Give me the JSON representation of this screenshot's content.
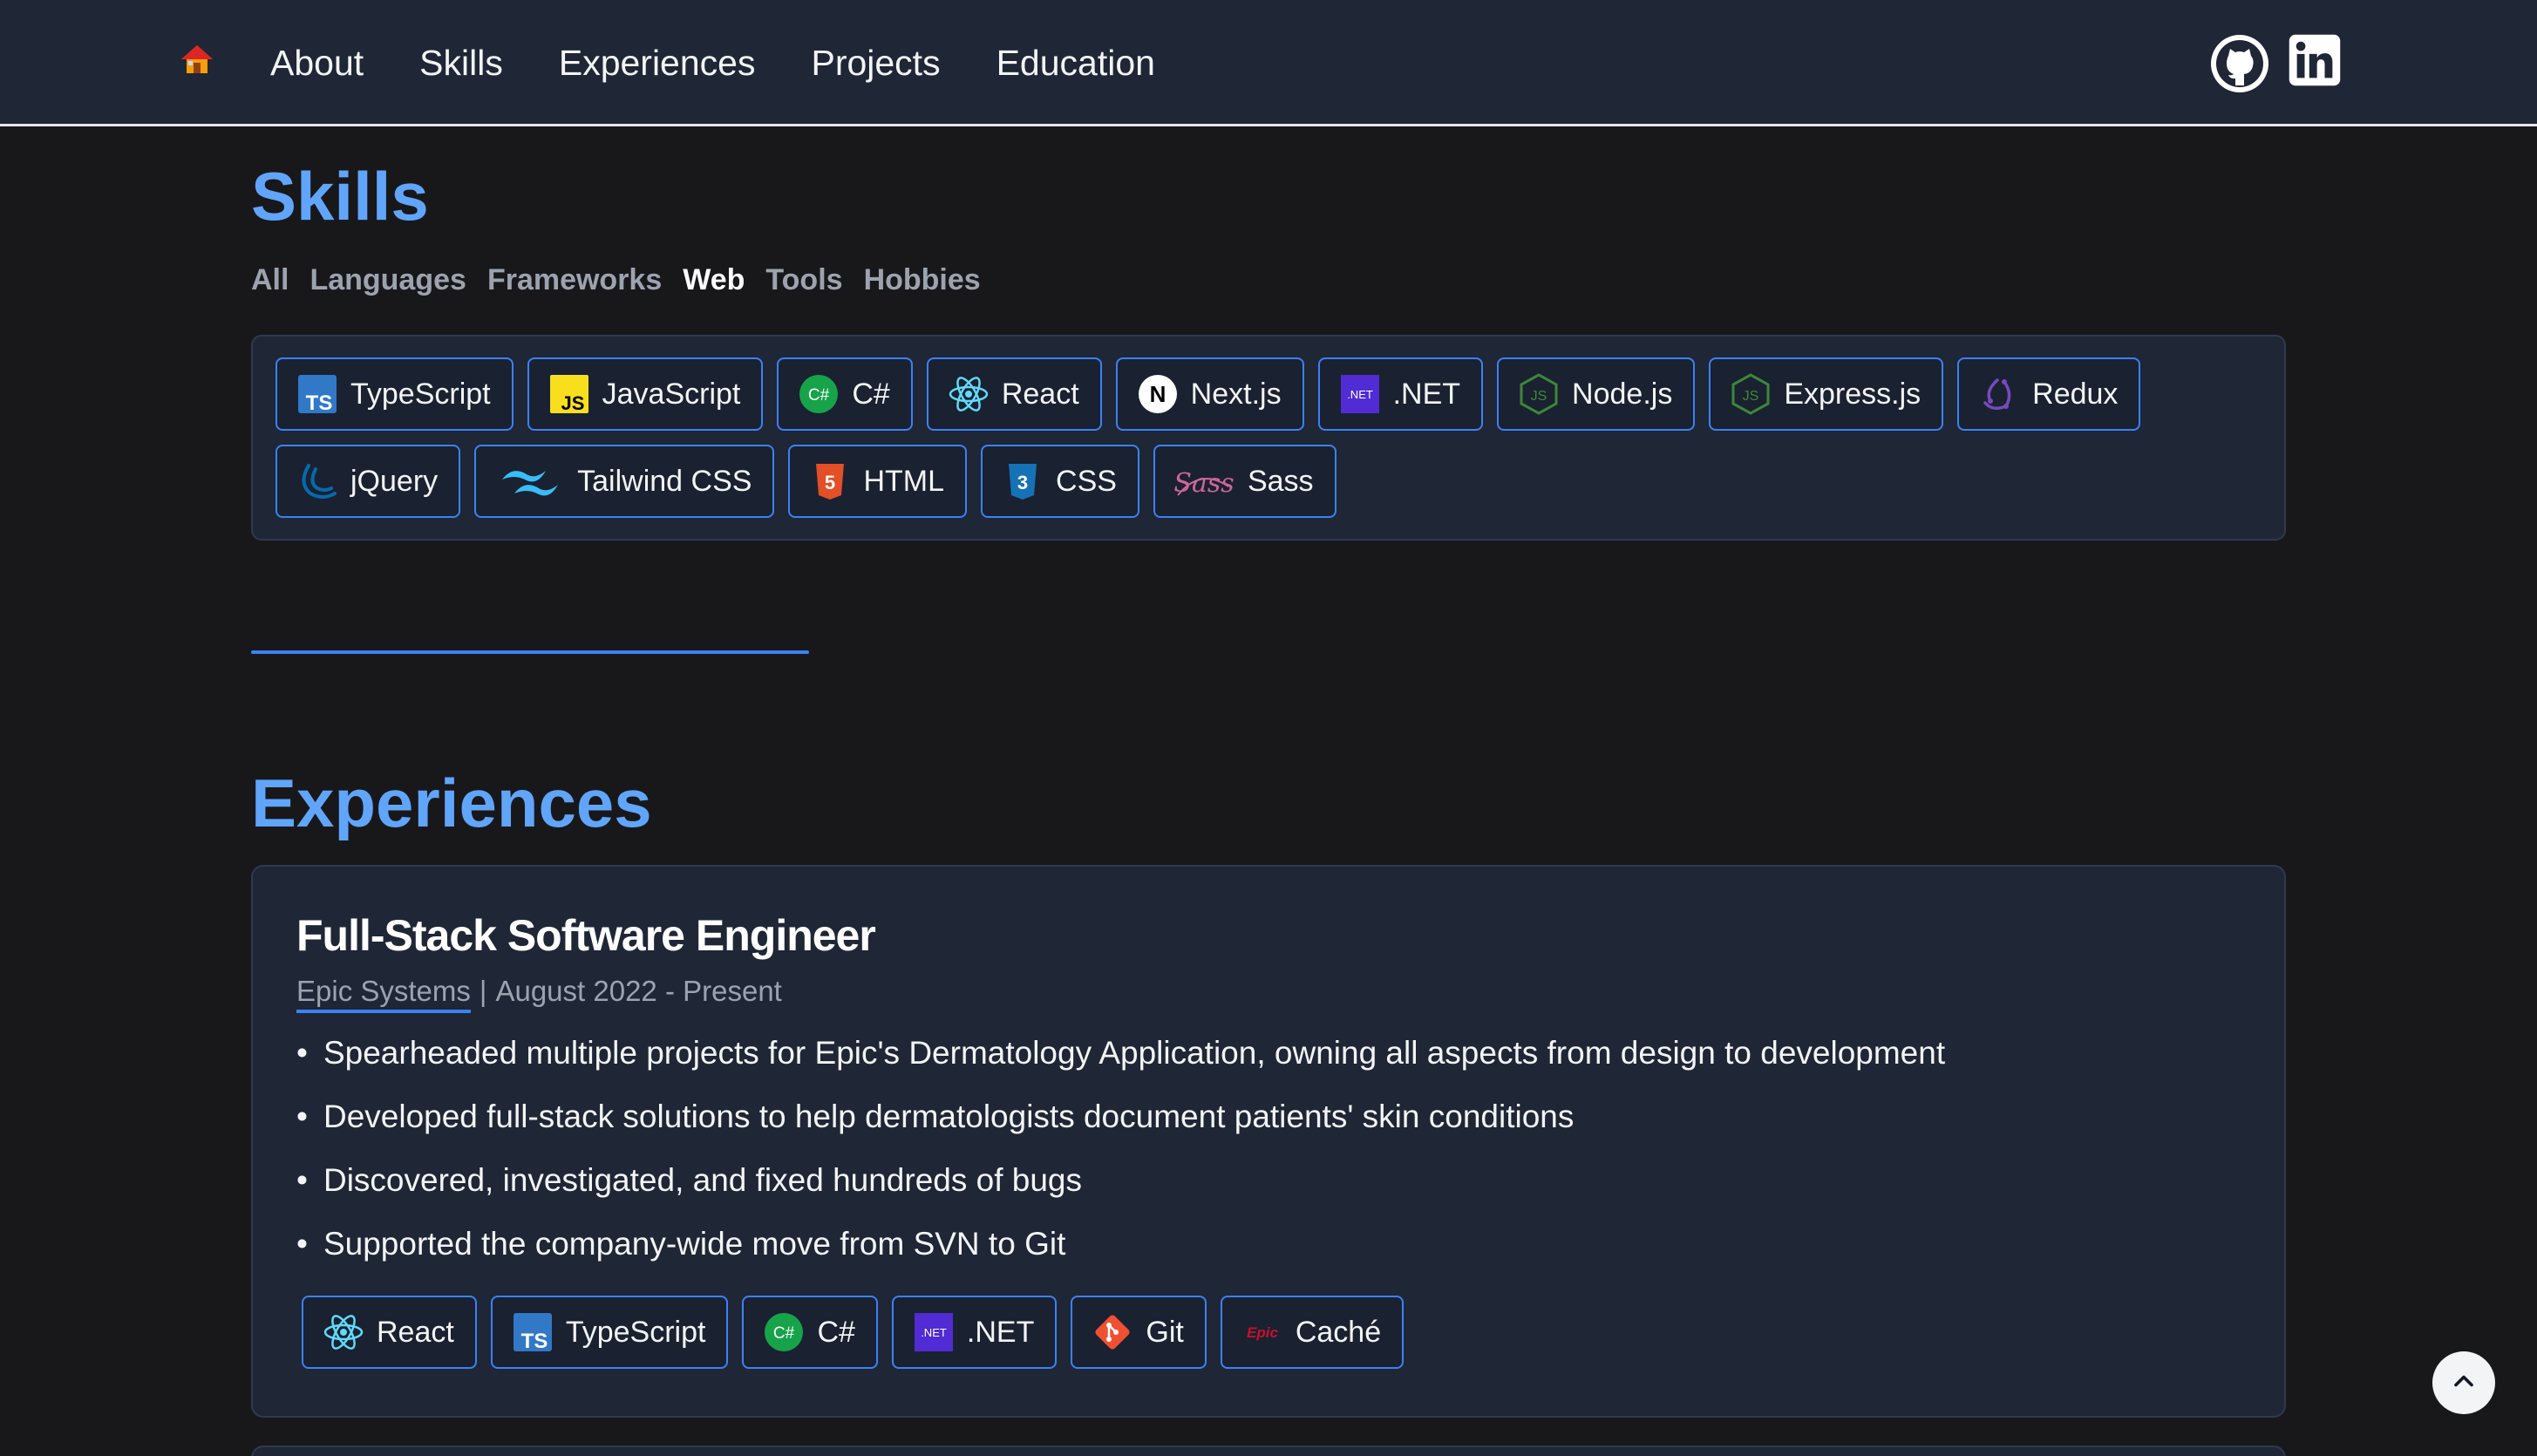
{
  "nav": {
    "home_icon": "house-icon",
    "links": [
      "About",
      "Skills",
      "Experiences",
      "Projects",
      "Education"
    ],
    "social": [
      {
        "icon": "github-icon"
      },
      {
        "icon": "linkedin-icon"
      }
    ]
  },
  "skills": {
    "title": "Skills",
    "filters": [
      "All",
      "Languages",
      "Frameworks",
      "Web",
      "Tools",
      "Hobbies"
    ],
    "active_filter": "Web",
    "rows": [
      [
        {
          "label": "TypeScript",
          "icon": "typescript-icon"
        },
        {
          "label": "JavaScript",
          "icon": "javascript-icon"
        },
        {
          "label": "C#",
          "icon": "csharp-icon"
        },
        {
          "label": "React",
          "icon": "react-icon"
        },
        {
          "label": "Next.js",
          "icon": "nextjs-icon"
        },
        {
          "label": ".NET",
          "icon": "dotnet-icon"
        },
        {
          "label": "Node.js",
          "icon": "nodejs-icon"
        },
        {
          "label": "Express.js",
          "icon": "nodejs-icon"
        },
        {
          "label": "Redux",
          "icon": "redux-icon"
        }
      ],
      [
        {
          "label": "jQuery",
          "icon": "jquery-icon"
        },
        {
          "label": "Tailwind CSS",
          "icon": "tailwind-icon"
        },
        {
          "label": "HTML",
          "icon": "html5-icon"
        },
        {
          "label": "CSS",
          "icon": "css3-icon"
        },
        {
          "label": "Sass",
          "icon": "sass-icon"
        }
      ]
    ]
  },
  "experiences": {
    "title": "Experiences",
    "items": [
      {
        "role": "Full-Stack Software Engineer",
        "company": "Epic Systems",
        "separator": "|",
        "dates": "August 2022 - Present",
        "bullets": [
          "Spearheaded multiple projects for Epic's Dermatology Application, owning all aspects from design to development",
          "Developed full-stack solutions to help dermatologists document patients' skin conditions",
          "Discovered, investigated, and fixed hundreds of bugs",
          "Supported the company-wide move from SVN to Git"
        ],
        "tags": [
          {
            "label": "React",
            "icon": "react-icon"
          },
          {
            "label": "TypeScript",
            "icon": "typescript-icon"
          },
          {
            "label": "C#",
            "icon": "csharp-icon"
          },
          {
            "label": ".NET",
            "icon": "dotnet-icon"
          },
          {
            "label": "Git",
            "icon": "git-icon"
          },
          {
            "label": "Caché",
            "icon": "epic-icon"
          }
        ]
      }
    ]
  },
  "scroll_top_icon": "chevron-up-icon",
  "colors": {
    "background": "#18181b",
    "panel": "#1f2636",
    "accent": "#60a5fa",
    "chip_border": "#3b82f6"
  }
}
